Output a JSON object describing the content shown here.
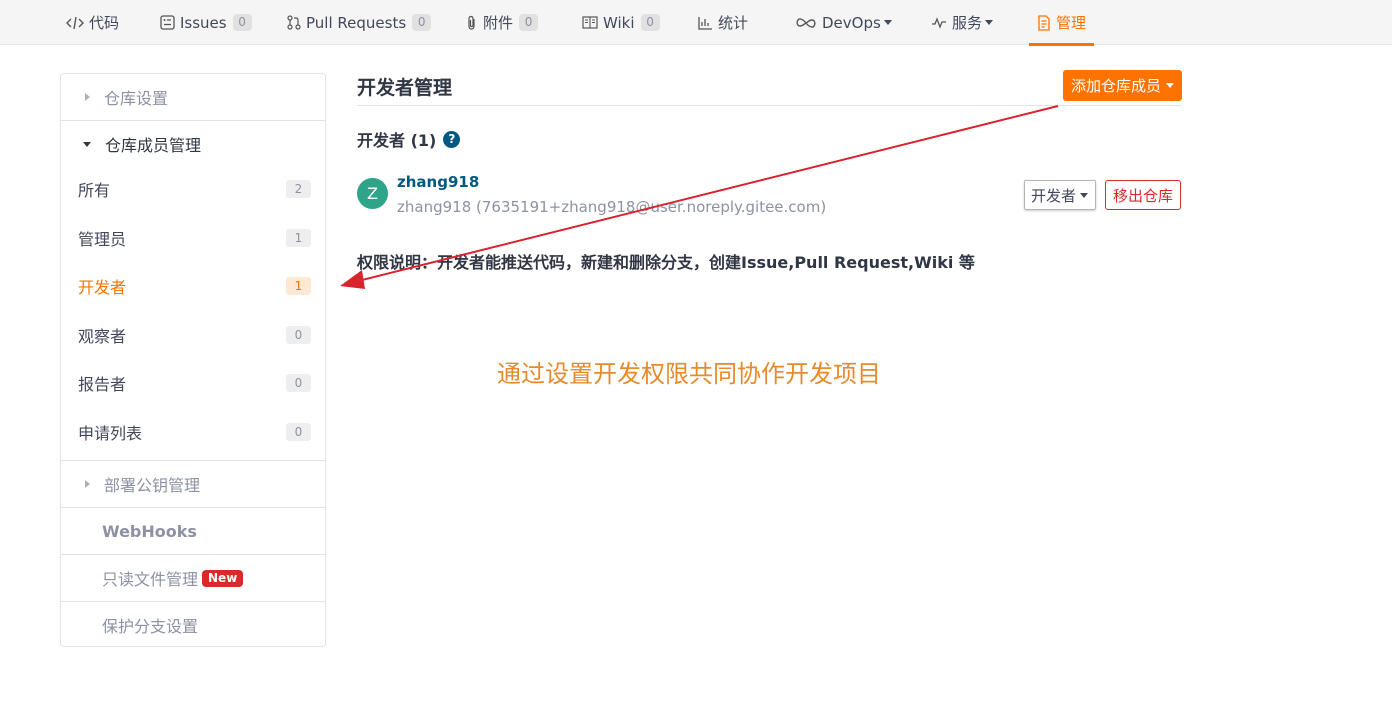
{
  "nav": {
    "tabs": [
      {
        "label": "代码",
        "icon": "code-icon"
      },
      {
        "label": "Issues",
        "count": "0",
        "icon": "issue-icon"
      },
      {
        "label": "Pull Requests",
        "count": "0",
        "icon": "pull-request-icon"
      },
      {
        "label": "附件",
        "count": "0",
        "icon": "paperclip-icon"
      },
      {
        "label": "Wiki",
        "count": "0",
        "icon": "book-icon"
      },
      {
        "label": "统计",
        "icon": "bar-chart-icon"
      },
      {
        "label": "DevOps",
        "icon": "infinity-icon"
      },
      {
        "label": "服务",
        "icon": "pulse-icon"
      },
      {
        "label": "管理",
        "icon": "settings-doc-icon",
        "active": true
      }
    ]
  },
  "sidebar": {
    "repo_settings": "仓库设置",
    "member_management": "仓库成员管理",
    "member_items": [
      {
        "label": "所有",
        "count": "2"
      },
      {
        "label": "管理员",
        "count": "1"
      },
      {
        "label": "开发者",
        "count": "1",
        "active": true
      },
      {
        "label": "观察者",
        "count": "0"
      },
      {
        "label": "报告者",
        "count": "0"
      },
      {
        "label": "申请列表",
        "count": "0"
      }
    ],
    "deploy_keys": "部署公钥管理",
    "webhooks": "WebHooks",
    "readonly_files": "只读文件管理",
    "new_badge": "New",
    "branch_protection": "保护分支设置"
  },
  "main": {
    "title": "开发者管理",
    "add_button": "添加仓库成员",
    "section_title": "开发者 (1)",
    "member": {
      "avatar_letter": "Z",
      "name": "zhang918",
      "email": "zhang918 (7635191+zhang918@user.noreply.gitee.com)",
      "role": "开发者",
      "remove_label": "移出仓库"
    },
    "permission_desc": "权限说明：开发者能推送代码，新建和删除分支，创建Issue,Pull Request,Wiki 等"
  },
  "annotation": {
    "text": "通过设置开发权限共同协作开发项目",
    "arrow_color": "#d9232d",
    "text_color": "#e88a2a"
  },
  "colors": {
    "accent": "#fe7300",
    "danger": "#db2828",
    "link": "#005980"
  }
}
